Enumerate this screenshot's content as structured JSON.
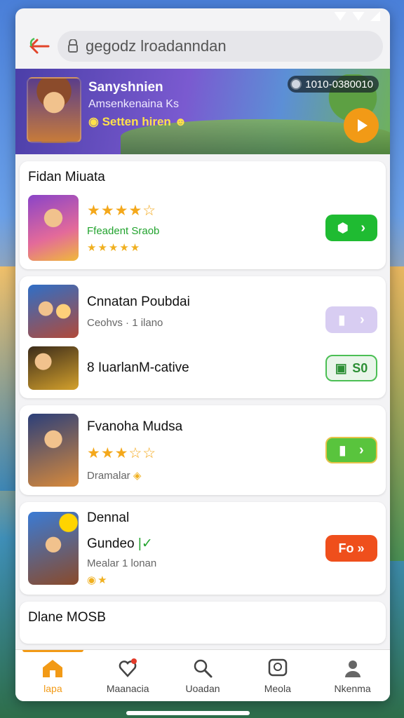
{
  "browser": {
    "url_text": "gegodz lroadanndan"
  },
  "banner": {
    "title": "Sanyshnien",
    "subtitle": "Amsenkenaina Ks",
    "cta": "Setten hiren",
    "counter": "1010-0380010"
  },
  "cards": [
    {
      "heading": "Fidan Miuata",
      "items": [
        {
          "rating_text": "★★★★☆",
          "label": "Ffeadent Sraob",
          "sub_rating": "★★★★★"
        }
      ]
    },
    {
      "heading": "Cnnatan Poubdai",
      "items": [
        {
          "meta": "Ceohvs · 1 ilano"
        },
        {
          "title": "8 IuarlanM-cative",
          "button_text": "S0"
        }
      ]
    },
    {
      "heading": "Fvanoha Mudsa",
      "items": [
        {
          "rating_text": "★★★☆☆",
          "meta": "Dramalar"
        }
      ]
    },
    {
      "heading": "Dennal",
      "items": [
        {
          "title": "Gundeo",
          "meta": "Mealar 1 lonan",
          "button_text": "Fo »"
        }
      ]
    },
    {
      "heading": "Dlane MOSB"
    }
  ],
  "nav": {
    "items": [
      {
        "label": "lapa",
        "icon": "home-icon"
      },
      {
        "label": "Maanacia",
        "icon": "heart-pin-icon"
      },
      {
        "label": "Uoadan",
        "icon": "search-icon"
      },
      {
        "label": "Meola",
        "icon": "chat-icon"
      },
      {
        "label": "Nkenma",
        "icon": "person-icon"
      }
    ]
  },
  "colors": {
    "accent_orange": "#f29a16",
    "green": "#1fbb32",
    "button_orange": "#ef4f1c"
  }
}
